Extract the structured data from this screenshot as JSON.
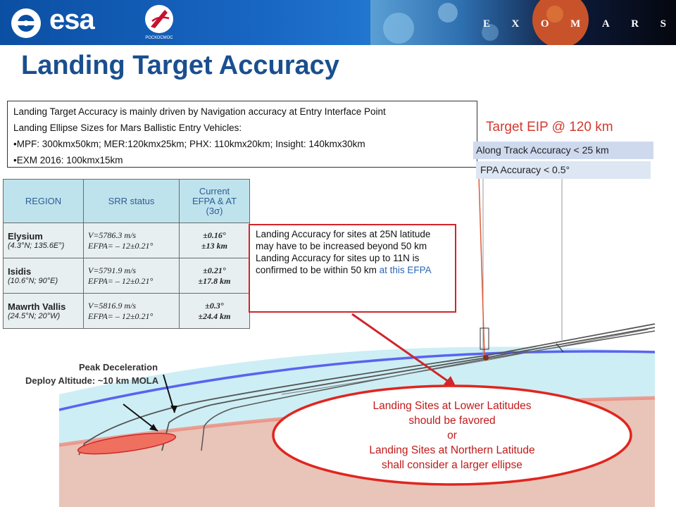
{
  "header": {
    "esa_logo_text": "esa",
    "roscosmos_label": "РОСКОСМОС",
    "exomars_letters": [
      "E",
      "X",
      "O",
      "M",
      "A",
      "R",
      "S"
    ]
  },
  "title": "Landing Target Accuracy",
  "info_box": {
    "lines": [
      "Landing Target Accuracy is mainly driven by Navigation accuracy at Entry Interface Point",
      "Landing Ellipse Sizes for Mars Ballistic Entry Vehicles:",
      "•MPF: 300kmx50km; MER:120kmx25km;  PHX: 110kmx20km; Insight: 140kmx30km",
      "•EXM 2016: 100kmx15km"
    ]
  },
  "region_table": {
    "headers": [
      "REGION",
      "SRR status",
      "Current EFPA & AT (3σ)"
    ],
    "header3_lines": [
      "Current",
      "EFPA & AT",
      "(3σ)"
    ],
    "rows": [
      {
        "name": "Elysium",
        "coords": "(4.3°N; 135.6E°)",
        "v": "V=5786.3 m/s",
        "efpa": "EFPA= – 12±0.21°",
        "acc1": "±0.16°",
        "acc2": "±13 km"
      },
      {
        "name": "Isidis",
        "coords": "(10.6°N; 90°E)",
        "v": "V=5791.9 m/s",
        "efpa": "EFPA= – 12±0.21°",
        "acc1": "±0.21°",
        "acc2": "±17.8 km"
      },
      {
        "name": "Mawrth Vallis",
        "coords": "(24.5°N; 20°W)",
        "v": "V=5816.9 m/s",
        "efpa": "EFPA= – 12±0.21°",
        "acc1": "±0.3°",
        "acc2": "±24.4 km"
      }
    ]
  },
  "note_box": {
    "text1": "Landing Accuracy for sites at 25N latitude may have to be increased beyond 50 km",
    "text2": "Landing Accuracy for sites up to 11N is confirmed to be within 50 km",
    "text2_blue": " at this EFPA"
  },
  "diagram": {
    "target_label": "Target EIP @ 120 km",
    "along_track": "Along Track Accuracy < 25 km",
    "fpa_accuracy": "FPA Accuracy < 0.5°",
    "peak_line1": "Peak Deceleration",
    "peak_line2": "Deploy Altitude: ~10 km MOLA"
  },
  "ellipse": {
    "lines": [
      "Landing Sites at Lower Latitudes",
      "should be favored",
      "or",
      "Landing Sites at Northern Latitude",
      "shall consider a larger ellipse"
    ]
  },
  "colors": {
    "header_blue": "#0b4fa3",
    "title_blue": "#1a4f8f",
    "accent_red": "#d0262a",
    "atmosphere": "#c9ecf3",
    "surface": "#e8c2b6"
  }
}
